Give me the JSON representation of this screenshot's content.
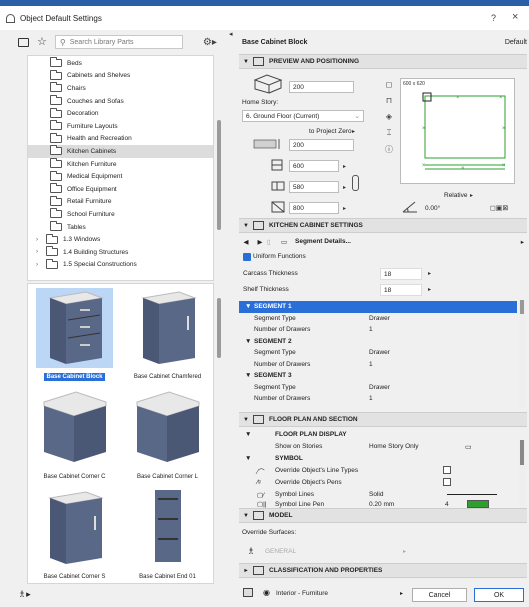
{
  "window": {
    "title": "Object Default Settings",
    "help": "?",
    "close": "×"
  },
  "library": {
    "search_placeholder": "Search Library Parts",
    "tree": [
      {
        "label": "Beds",
        "level": 1
      },
      {
        "label": "Cabinets and Shelves",
        "level": 1
      },
      {
        "label": "Chairs",
        "level": 1
      },
      {
        "label": "Couches and Sofas",
        "level": 1
      },
      {
        "label": "Decoration",
        "level": 1
      },
      {
        "label": "Furniture Layouts",
        "level": 1
      },
      {
        "label": "Health and Recreation",
        "level": 1
      },
      {
        "label": "Kitchen Cabinets",
        "level": 1,
        "selected": true
      },
      {
        "label": "Kitchen Furniture",
        "level": 1
      },
      {
        "label": "Medical Equipment",
        "level": 1
      },
      {
        "label": "Office Equipment",
        "level": 1
      },
      {
        "label": "Retail Furniture",
        "level": 1
      },
      {
        "label": "School Furniture",
        "level": 1
      },
      {
        "label": "Tables",
        "level": 1
      },
      {
        "label": "1.3 Windows",
        "level": 0
      },
      {
        "label": "1.4 Building Structures",
        "level": 0
      },
      {
        "label": "1.5 Special Constructions",
        "level": 0
      }
    ],
    "thumbnails": [
      {
        "label": "Base Cabinet Block",
        "selected": true
      },
      {
        "label": "Base Cabinet Chamfered"
      },
      {
        "label": "Base Cabinet Corner C"
      },
      {
        "label": "Base Cabinet Corner L"
      },
      {
        "label": "Base Cabinet Corner S"
      },
      {
        "label": "Base Cabinet End 01"
      }
    ]
  },
  "settings": {
    "object_name": "Base Cabinet Block",
    "default_label": "Default",
    "preview_section": "PREVIEW AND POSITIONING",
    "top_offset": "200",
    "home_story_label": "Home Story:",
    "home_story_value": "6. Ground Floor (Current)",
    "to_project_zero": "to Project Zero",
    "elevation": "200",
    "width": "600",
    "depth": "580",
    "height": "800",
    "preview_size": "600 x 620",
    "relative_label": "Relative",
    "angle": "0.00°",
    "kitchen_section": "KITCHEN CABINET SETTINGS",
    "segment_details": "Segment Details...",
    "uniform_functions": "Uniform Functions",
    "carcass_label": "Carcass Thickness",
    "carcass_value": "18",
    "shelf_label": "Shelf Thickness",
    "shelf_value": "18",
    "segments": [
      {
        "title": "SEGMENT 1",
        "type_label": "Segment Type",
        "type_value": "Drawer",
        "drawers_label": "Number of Drawers",
        "drawers_value": "1"
      },
      {
        "title": "SEGMENT 2",
        "type_label": "Segment Type",
        "type_value": "Drawer",
        "drawers_label": "Number of Drawers",
        "drawers_value": "1"
      },
      {
        "title": "SEGMENT 3",
        "type_label": "Segment Type",
        "type_value": "Drawer",
        "drawers_label": "Number of Drawers",
        "drawers_value": "1"
      }
    ],
    "floorplan_section": "FLOOR PLAN AND SECTION",
    "floorplan_display": "FLOOR PLAN DISPLAY",
    "show_on_stories_label": "Show on Stories",
    "show_on_stories_value": "Home Story Only",
    "symbol_label": "SYMBOL",
    "override_line_types": "Override Object's Line Types",
    "override_pens": "Override Object's Pens",
    "symbol_lines": "Symbol Lines",
    "symbol_lines_value": "Solid",
    "symbol_line_pen": "Symbol Line Pen",
    "symbol_line_pen_value": "0.20 mm",
    "symbol_line_pen_num": "4",
    "model_section": "MODEL",
    "override_surfaces": "Override Surfaces:",
    "general_label": "GENERAL",
    "classification_section": "CLASSIFICATION AND PROPERTIES"
  },
  "footer": {
    "layer": "Interior - Furniture",
    "cancel": "Cancel",
    "ok": "OK"
  },
  "colors": {
    "accent": "#2a6ed8",
    "cabinet": "#5a6888",
    "preview_green": "#2ca02c"
  }
}
